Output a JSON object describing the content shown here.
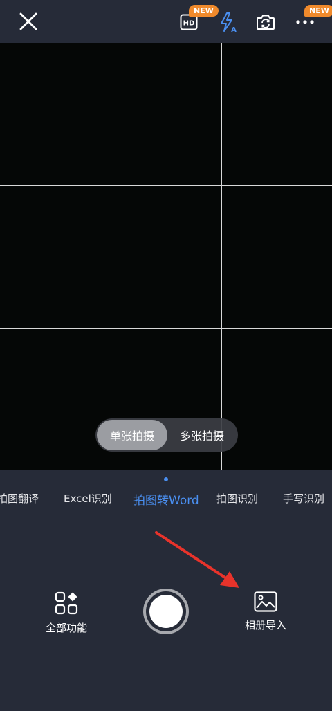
{
  "topbar": {
    "close_icon": "close-icon",
    "hd_icon": "hd-icon",
    "hd_badge": "NEW",
    "flash_icon": "flash-auto-icon",
    "camera_switch_icon": "camera-switch-icon",
    "more_icon": "more-icon",
    "more_badge": "NEW"
  },
  "viewfinder": {
    "mode_toggle": {
      "single": "单张拍摄",
      "multi": "多张拍摄",
      "selected": "单张拍摄"
    }
  },
  "modes": {
    "items": [
      "拍图翻译",
      "Excel识别",
      "拍图转Word",
      "拍图识别",
      "手写识别"
    ],
    "active": "拍图转Word"
  },
  "controls": {
    "all_features_label": "全部功能",
    "all_features_icon": "apps-icon",
    "album_label": "相册导入",
    "album_icon": "image-icon",
    "shutter_icon": "shutter-button"
  },
  "colors": {
    "background": "#262b38",
    "accent": "#4a8ff0",
    "badge": "#f08a2c",
    "annotation_arrow": "#e8332b"
  }
}
